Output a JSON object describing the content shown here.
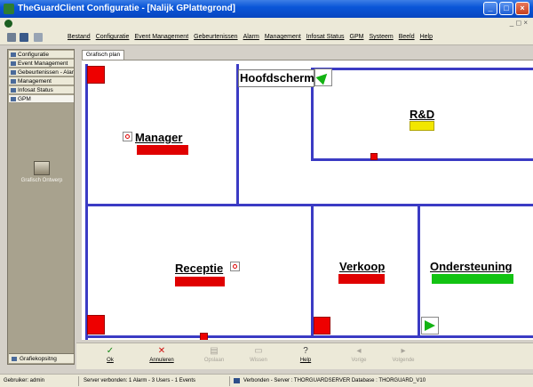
{
  "window": {
    "title": "TheGuardClient  Configuratie - [Nalijk GPlattegrond]",
    "minimize": "_",
    "maximize": "□",
    "close": "×",
    "mdi_controls": "_ ◻ ×"
  },
  "menu": {
    "items": [
      "Bestand",
      "Configuratie",
      "Event Management",
      "Gebeurtenissen",
      "Alarm",
      "Management",
      "Infosat Status",
      "GPM",
      "Systeem",
      "Beeld",
      "Help"
    ]
  },
  "sidebar": {
    "items": [
      {
        "label": "Configuratie",
        "icon": "gear-icon"
      },
      {
        "label": "Event Management",
        "icon": "event-icon"
      },
      {
        "label": "Gebeurtenissen - Alar",
        "icon": "list-icon"
      },
      {
        "label": "Management",
        "icon": "folder-icon"
      },
      {
        "label": "Infosat Status",
        "icon": "status-icon"
      },
      {
        "label": "GPM",
        "icon": "map-icon"
      }
    ],
    "sub_item_label": "Grafisch Ontwerp",
    "bottom_item_label": "Grafiekopsitng"
  },
  "document": {
    "tab_label": "Grafisch plan"
  },
  "floorplan": {
    "rooms": {
      "hoofdscherm": "Hoofdscherm",
      "rnd": "R&D",
      "manager": "Manager",
      "receptie": "Receptie",
      "verkoop": "Verkoop",
      "ondersteuning": "Ondersteuning"
    },
    "colors": {
      "wall": "#3b3bc4",
      "alarm_red": "#e00000",
      "rnd_yellow": "#f2e600",
      "ok_green": "#13c313"
    }
  },
  "toolbar": {
    "buttons": [
      {
        "label": "Ok",
        "icon": "checkmark-icon",
        "glyph": "✓",
        "enabled": true
      },
      {
        "label": "Annuleren",
        "icon": "cancel-icon",
        "glyph": "✕",
        "enabled": true
      },
      {
        "label": "Opslaan",
        "icon": "save-icon",
        "glyph": "▤",
        "enabled": false
      },
      {
        "label": "Wissen",
        "icon": "clear-icon",
        "glyph": "▭",
        "enabled": false
      },
      {
        "label": "Help",
        "icon": "help-icon",
        "glyph": "?",
        "enabled": true
      },
      {
        "label": "Vorige",
        "icon": "back-icon",
        "glyph": "◂",
        "enabled": false
      },
      {
        "label": "Volgende",
        "icon": "forward-icon",
        "glyph": "▸",
        "enabled": false
      }
    ]
  },
  "statusbar": {
    "user": "Gebruiker: admin",
    "server": "Server verbonden: 1 Alarm - 3 Users - 1 Events",
    "connection": "Verbonden - Server : THORGUARDSERVER Database : THORGUARD_V10"
  }
}
